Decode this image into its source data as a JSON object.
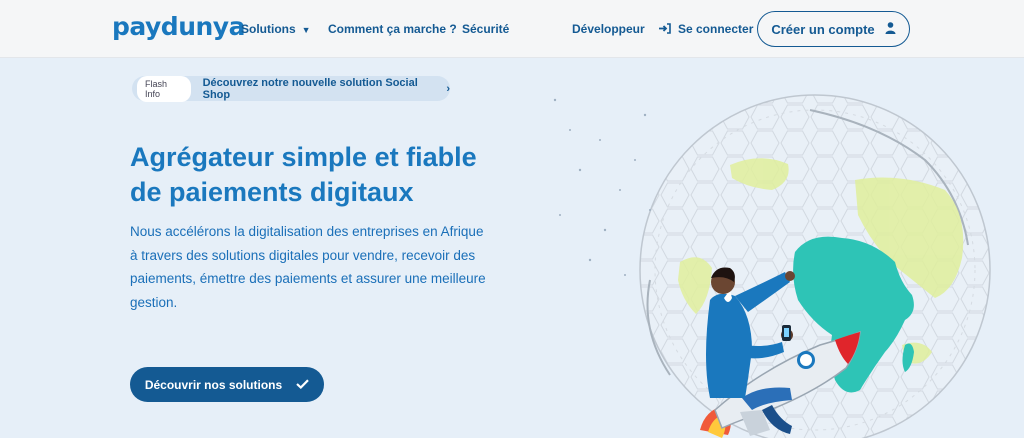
{
  "header": {
    "logo": "paydunya",
    "nav": {
      "solutions": "Solutions",
      "how_it_works": "Comment ça marche ?",
      "security": "Sécurité",
      "developer": "Développeur",
      "login": "Se connecter"
    },
    "signup_button": "Créer un compte"
  },
  "flash": {
    "badge": "Flash Info",
    "text": "Découvrez notre nouvelle solution Social Shop"
  },
  "hero": {
    "title_line1": "Agrégateur simple et fiable",
    "title_line2": "de paiements digitaux",
    "description": "Nous accélérons la digitalisation des entreprises en Afrique à travers des solutions digitales pour vendre, recevoir des paiements, émettre des paiements et assurer une meilleure gestion.",
    "cta_button": "Découvrir nos solutions"
  },
  "colors": {
    "primary": "#145a93",
    "accent": "#1a78be",
    "background": "#e6eff8",
    "africa": "#2ec4b6",
    "globe_land": "#e0ef9c"
  },
  "icons": {
    "nav_chevron": "chevron-down-icon",
    "login": "login-arrow-icon",
    "account": "user-icon",
    "flash_chevron": "chevron-right-icon",
    "cta": "check-icon"
  }
}
